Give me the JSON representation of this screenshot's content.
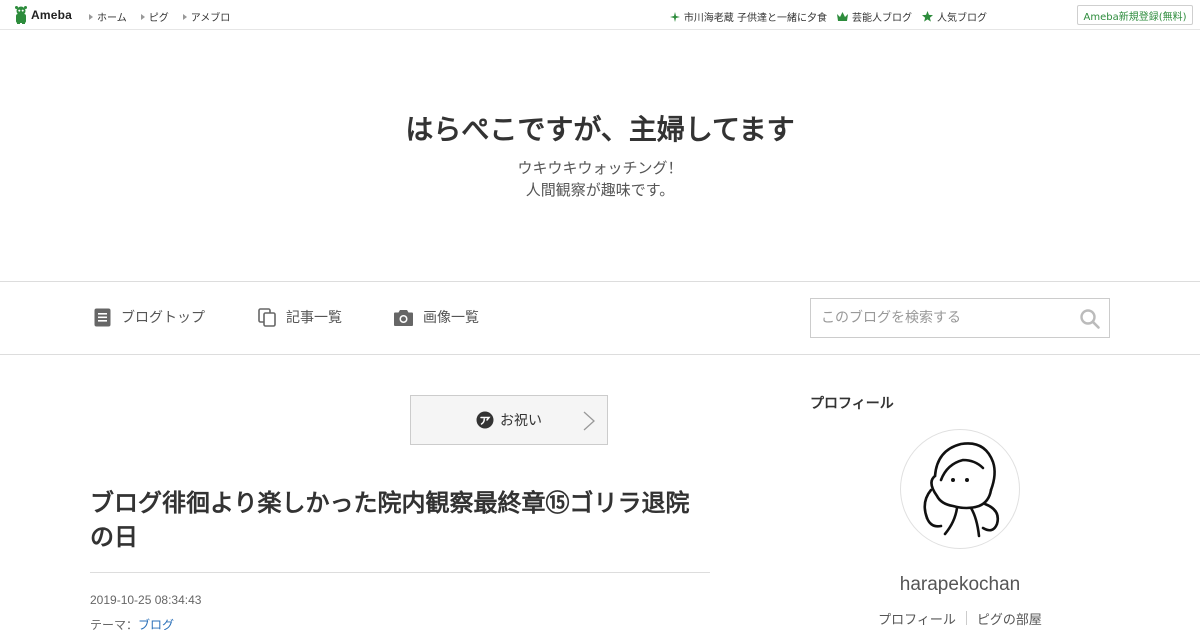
{
  "topbar": {
    "logo_text": "Ameba",
    "nav": [
      {
        "label": "ホーム"
      },
      {
        "label": "ピグ"
      },
      {
        "label": "アメブロ"
      }
    ],
    "links": [
      {
        "icon": "sparkle-icon",
        "label": "市川海老蔵 子供達と一緒に夕食"
      },
      {
        "icon": "crown-icon",
        "label": "芸能人ブログ"
      },
      {
        "icon": "star-icon",
        "label": "人気ブログ"
      }
    ],
    "register_label": "Ameba新規登録(無料)"
  },
  "header": {
    "title": "はらぺこですが、主婦してます",
    "description_line1": "ウキウキウォッチング！",
    "description_line2": "人間観察が趣味です。"
  },
  "nav": {
    "items": [
      {
        "icon": "document-icon",
        "label": "ブログトップ"
      },
      {
        "icon": "copy-icon",
        "label": "記事一覧"
      },
      {
        "icon": "camera-icon",
        "label": "画像一覧"
      }
    ],
    "search_placeholder": "このブログを検索する"
  },
  "article": {
    "theme_label": "お祝い",
    "title": "ブログ徘徊より楽しかった院内観察最終章⑮ゴリラ退院の日",
    "date": "2019-10-25 08:34:43",
    "theme_prefix": "テーマ：",
    "theme_link": "ブログ"
  },
  "sidebar": {
    "heading": "プロフィール",
    "username": "harapekochan",
    "links": [
      {
        "label": "プロフィール"
      },
      {
        "label": "ピグの部屋"
      }
    ]
  },
  "colors": {
    "ameba_green": "#2d8c3c",
    "link_blue": "#2a6fb8",
    "text": "#333333"
  }
}
